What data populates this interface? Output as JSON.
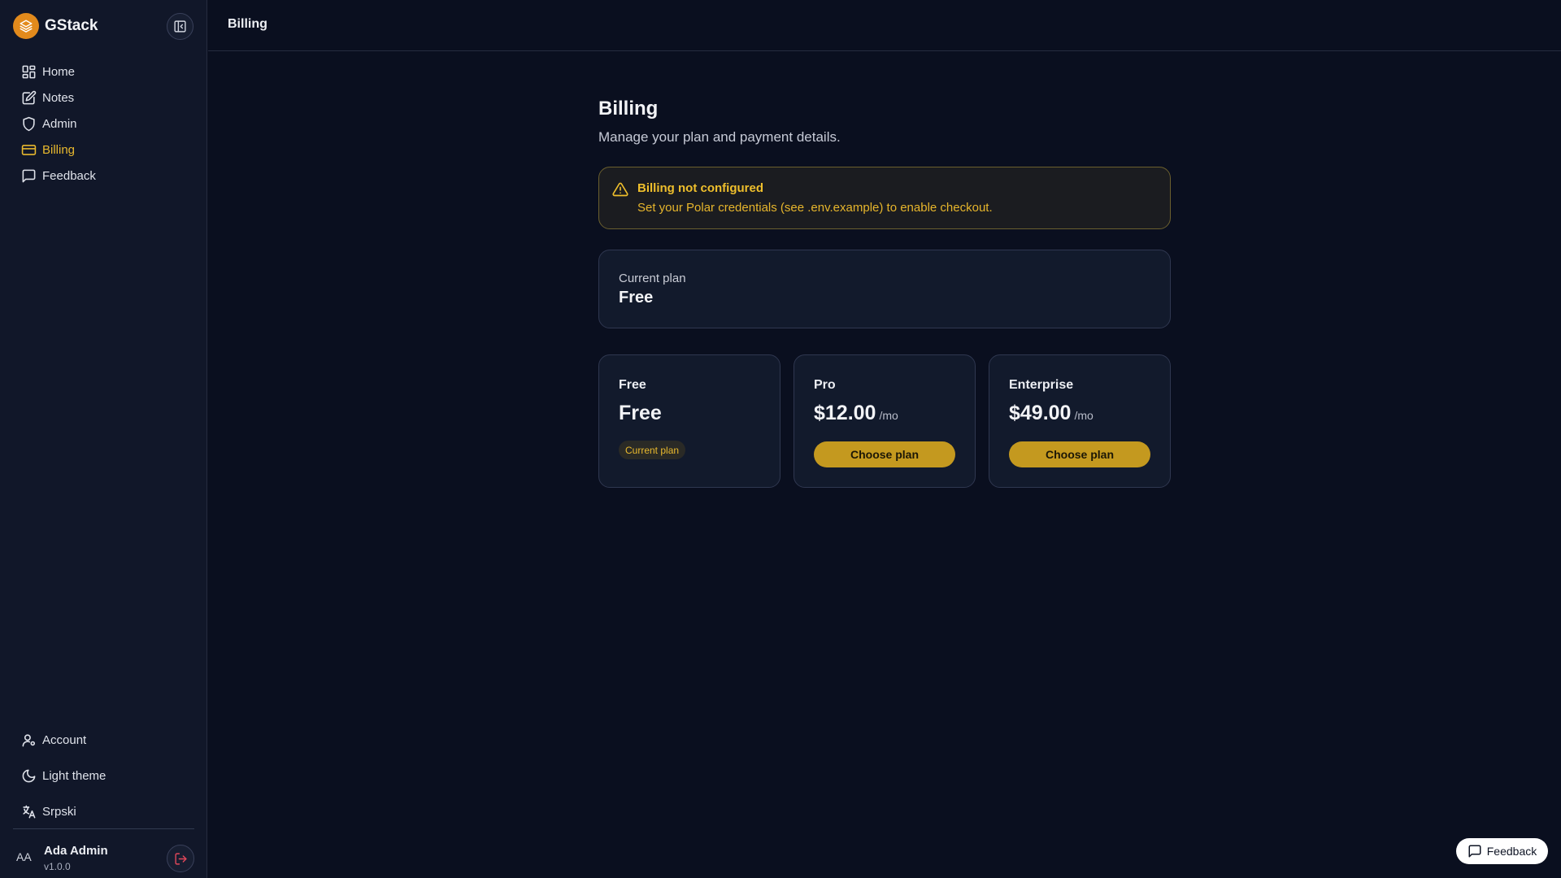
{
  "brand": {
    "name": "GStack"
  },
  "sidebar": {
    "nav": [
      {
        "label": "Home",
        "icon": "grid-icon"
      },
      {
        "label": "Notes",
        "icon": "notes-icon"
      },
      {
        "label": "Admin",
        "icon": "shield-icon"
      },
      {
        "label": "Billing",
        "icon": "credit-card-icon",
        "active": true
      },
      {
        "label": "Feedback",
        "icon": "message-icon"
      }
    ],
    "bottom": [
      {
        "label": "Account",
        "icon": "user-gear-icon"
      },
      {
        "label": "Light theme",
        "icon": "moon-icon"
      },
      {
        "label": "Srpski",
        "icon": "translate-icon"
      }
    ],
    "user": {
      "initials": "AA",
      "name": "Ada Admin",
      "version": "v1.0.0"
    }
  },
  "topbar": {
    "title": "Billing"
  },
  "page": {
    "title": "Billing",
    "subtitle": "Manage your plan and payment details."
  },
  "alert": {
    "title": "Billing not configured",
    "text": "Set your Polar credentials (see .env.example) to enable checkout."
  },
  "current_plan": {
    "label": "Current plan",
    "value": "Free"
  },
  "plans": [
    {
      "name": "Free",
      "price": "Free",
      "period": "",
      "badge": "Current plan"
    },
    {
      "name": "Pro",
      "price": "$12.00",
      "period": "/mo",
      "button": "Choose plan"
    },
    {
      "name": "Enterprise",
      "price": "$49.00",
      "period": "/mo",
      "button": "Choose plan"
    }
  ],
  "feedback_button": {
    "label": "Feedback"
  },
  "colors": {
    "accent": "#e9b92e",
    "background": "#0a0f1f",
    "sidebar": "#111729",
    "brand_logo": "#e28a1c"
  }
}
